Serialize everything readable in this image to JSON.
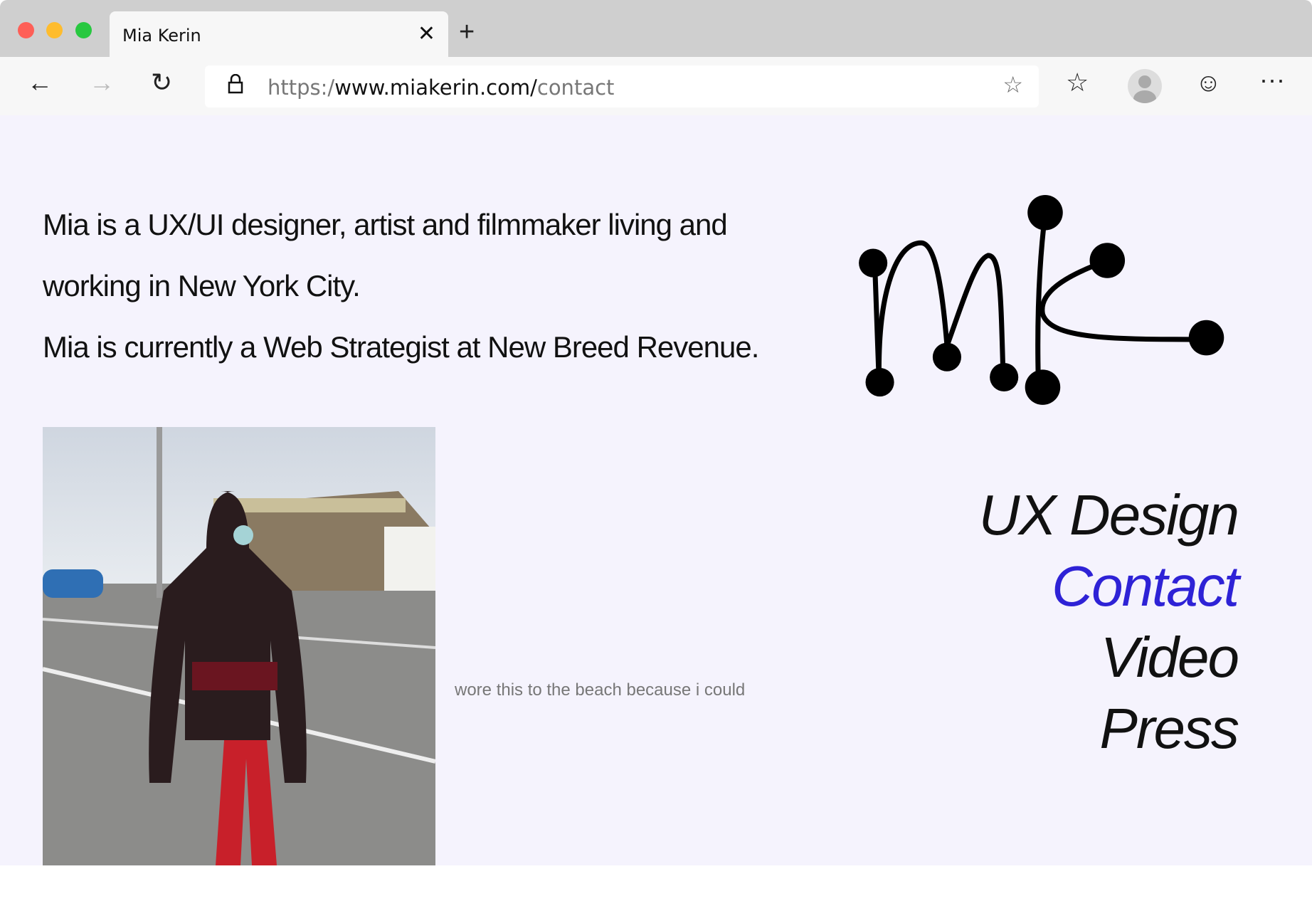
{
  "browser": {
    "tab_title": "Mia Kerin",
    "url_scheme": "https:/",
    "url_domain": "www.miakerin.com/",
    "url_path": "contact"
  },
  "bio": {
    "line1": "Mia is a UX/UI designer, artist and filmmaker living and",
    "line2": "working in New York City.",
    "line3": "Mia is currently a Web Strategist at New Breed Revenue."
  },
  "photo": {
    "caption": "wore this to the beach because i could"
  },
  "nav": {
    "items": [
      {
        "label": "UX Design"
      },
      {
        "label": "Contact",
        "active": true
      },
      {
        "label": "Video"
      },
      {
        "label": "Press"
      }
    ]
  },
  "colors": {
    "accent": "#2e22d6",
    "page_bg": "#f5f3fd"
  }
}
